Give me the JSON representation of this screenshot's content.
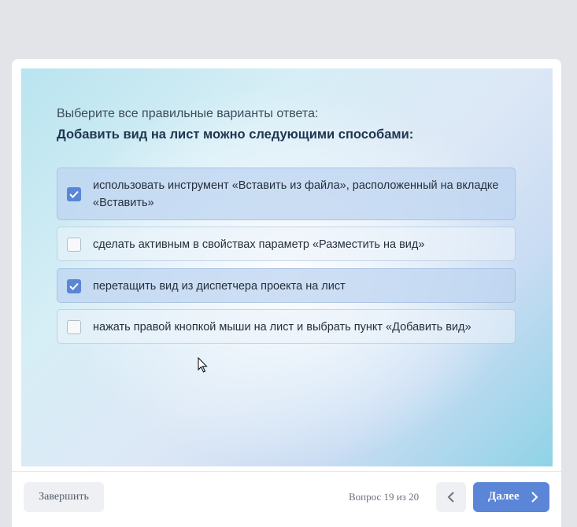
{
  "quiz": {
    "prompt": "Выберите все правильные варианты ответа:",
    "question": "Добавить вид на лист можно следующими способами:",
    "options": [
      {
        "text": "использовать инструмент «Вставить из файла», расположенный на вкладке «Вставить»",
        "checked": true
      },
      {
        "text": "сделать активным в свойствах параметр «Разместить на вид»",
        "checked": false
      },
      {
        "text": "перетащить вид из диспетчера проекта на лист",
        "checked": true
      },
      {
        "text": "нажать правой кнопкой мыши на лист и выбрать пункт «Добавить вид»",
        "checked": false
      }
    ]
  },
  "footer": {
    "finish_label": "Завершить",
    "counter": "Вопрос 19 из 20",
    "next_label": "Далее",
    "prev_icon": "chevron-left-icon",
    "next_icon": "chevron-right-icon"
  },
  "colors": {
    "accent": "#5b86d8",
    "checked_option_bg": "#bed4f0"
  }
}
